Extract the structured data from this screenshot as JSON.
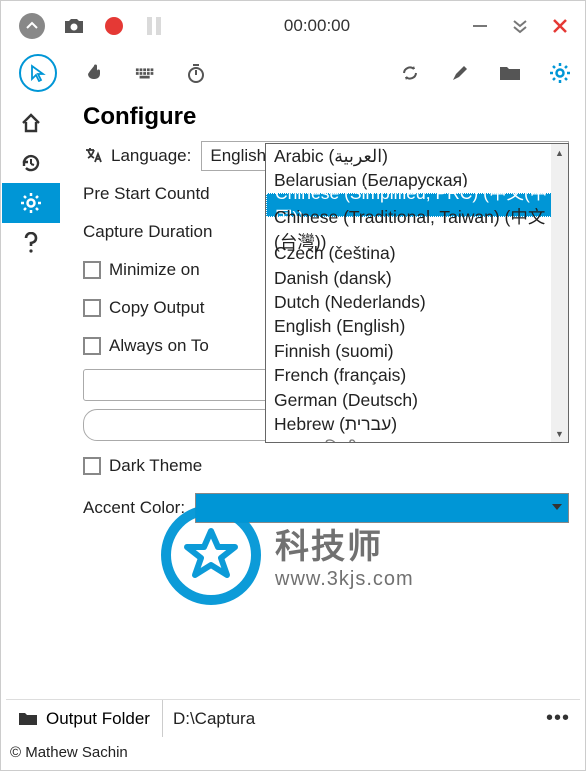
{
  "titlebar": {
    "timer": "00:00:00"
  },
  "page": {
    "heading": "Configure",
    "language_label": "Language:",
    "language_value": "English (English)",
    "prestart_label": "Pre Start Countd",
    "capduration_label": "Capture Duration",
    "minimize_label": "Minimize on",
    "copyoutput_label": "Copy Output",
    "alwaystop_label": "Always on To",
    "darktheme_label": "Dark Theme",
    "accent_label": "Accent Color:"
  },
  "dropdown": {
    "items": [
      "Arabic (العربية)",
      "Belarusian (Беларуская)",
      "Chinese (Simplified, PRC) (中文(中国))",
      "Chinese (Traditional, Taiwan) (中文(台灣))",
      "Czech (čeština)",
      "Danish (dansk)",
      "Dutch (Nederlands)",
      "English (English)",
      "Finnish (suomi)",
      "French (français)",
      "German (Deutsch)",
      "Hebrew (עברית)"
    ],
    "partial": "Hindi (हिन्दी)",
    "selected_index": 2
  },
  "footer": {
    "folder_label": "Output Folder",
    "path": "D:\\Captura",
    "more": "•••",
    "copyright": "© Mathew Sachin"
  },
  "watermark": {
    "line1": "科技师",
    "line2": "www.3kjs.com"
  }
}
